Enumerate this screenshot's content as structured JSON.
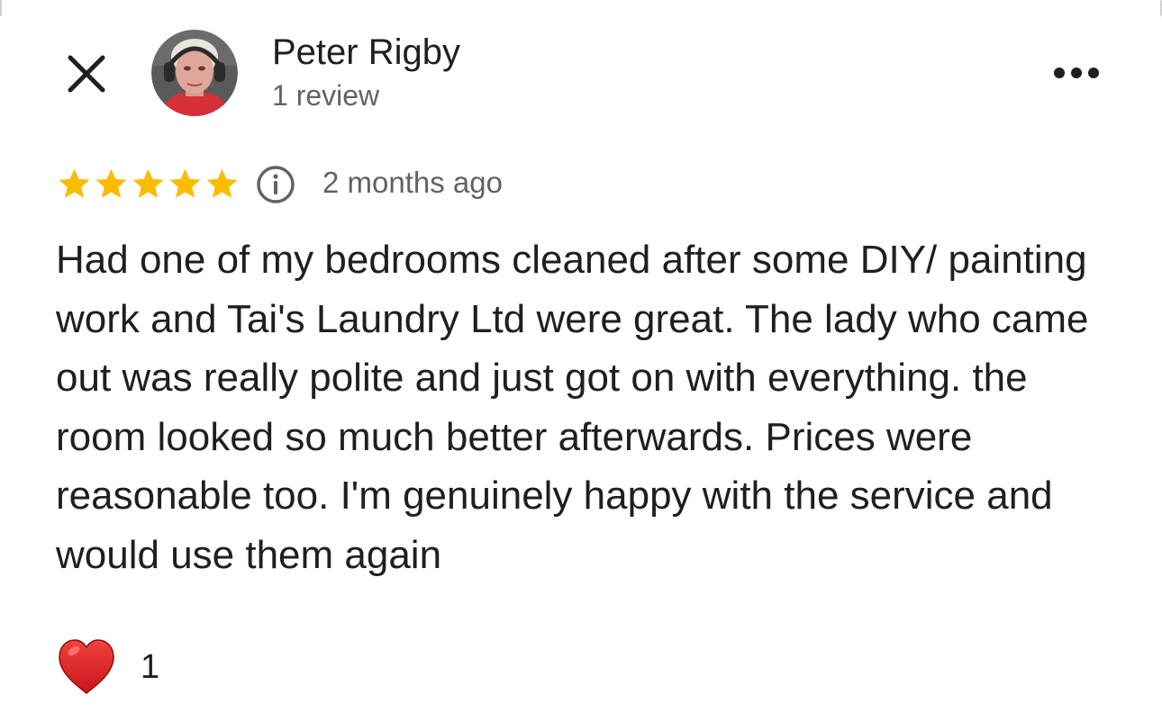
{
  "review": {
    "author": {
      "name": "Peter Rigby",
      "review_count": "1 review",
      "avatar": "profile-photo"
    },
    "rating": {
      "stars": 5,
      "max_stars": 5,
      "star_color": "#FBBC04"
    },
    "date": "2 months ago",
    "text": "Had one of my bedrooms cleaned after some DIY/ painting work and Tai's Laundry Ltd were great. The lady who came out was really polite and just got on with everything. the room looked so much better afterwards. Prices were reasonable too. I'm genuinely happy with the service and would use them again",
    "reactions": {
      "icon": "heart-icon",
      "count": "1",
      "color": "#E53935"
    }
  },
  "icons": {
    "close": "close-icon",
    "more": "more-options-icon",
    "info": "info-icon"
  }
}
